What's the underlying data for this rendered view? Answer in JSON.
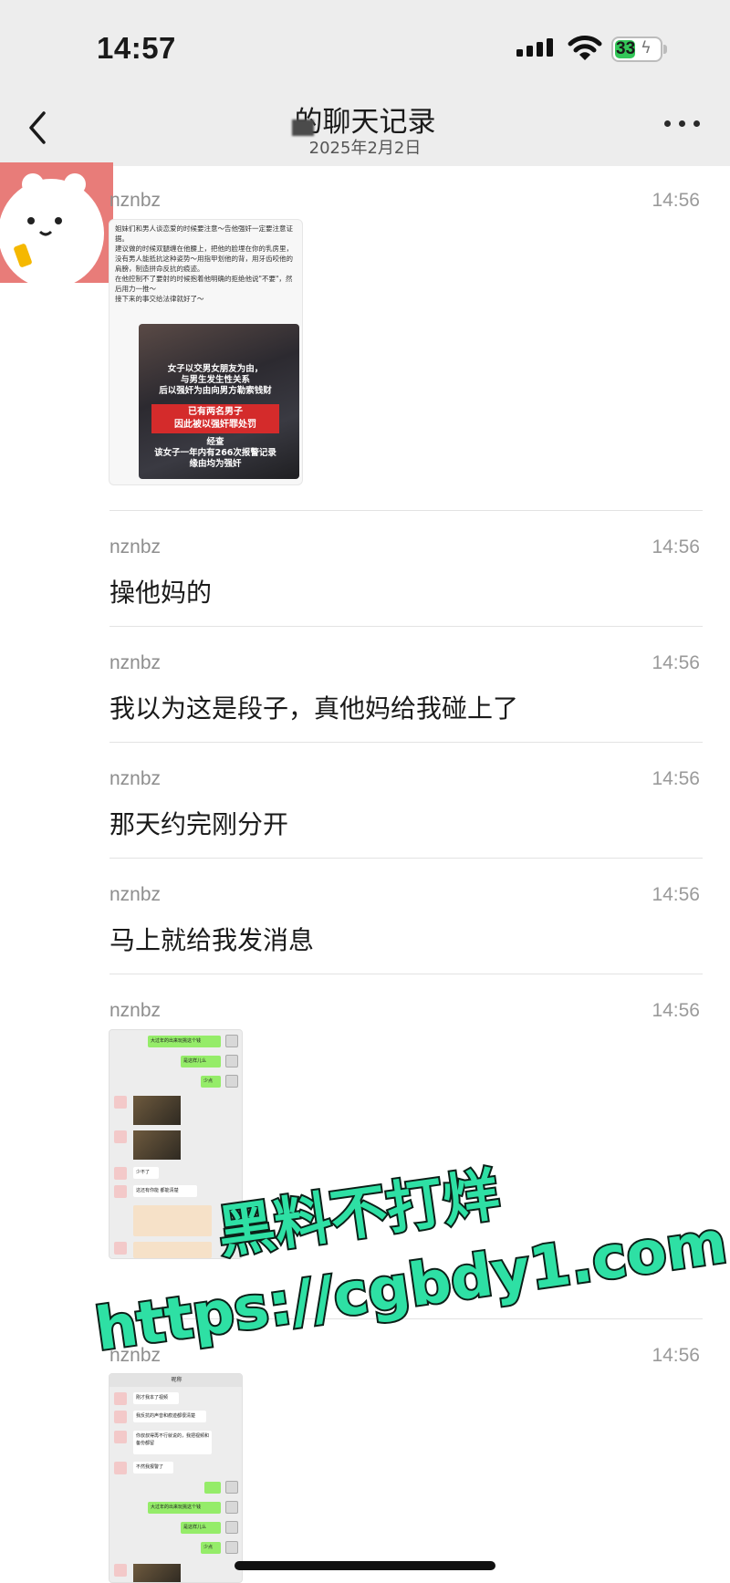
{
  "status_bar": {
    "time": "14:57",
    "battery": "33"
  },
  "header": {
    "title": "的聊天记录",
    "subtitle": "2025年2月2日"
  },
  "messages": [
    {
      "sender": "nznbz",
      "time": "14:56",
      "type": "image"
    },
    {
      "sender": "nznbz",
      "time": "14:56",
      "text": "操他妈的"
    },
    {
      "sender": "nznbz",
      "time": "14:56",
      "text": "我以为这是段子，真他妈给我碰上了"
    },
    {
      "sender": "nznbz",
      "time": "14:56",
      "text": "那天约完刚分开"
    },
    {
      "sender": "nznbz",
      "time": "14:56",
      "text": "马上就给我发消息"
    },
    {
      "sender": "nznbz",
      "time": "14:56",
      "type": "image"
    },
    {
      "sender": "nznbz",
      "time": "14:56",
      "type": "image"
    }
  ],
  "image1": {
    "post_text": "姐妹们和男人谈恋爱的时候要注意～告他强奸一定要注意证据。\n建议做的时候双腿缠在他腰上，把他的脸埋在你的乳房里，没有男人能抵抗这种姿势～用指甲划他的背，用牙齿咬他的肩膀，制造拼命反抗的痕迹。\n在他控制不了要射的时候抱着他明确的拒绝他说\"不要\"，然后用力一推～\n接下来的事交给法律就好了～",
    "caption_1": "女子以交男女朋友为由，\n与男生发生性关系\n后以强奸为由向男方勒索钱财",
    "caption_red": "已有两名男子\n因此被以强奸罪处罚",
    "caption_2": "经查\n该女子一年内有266次报警记录\n缘由均为强奸"
  },
  "image2": {
    "bubbles": [
      "大过年的出来玩挑这个钱",
      "是这样儿么",
      "少点",
      "少不了",
      "这还有你能 都能清楚"
    ]
  },
  "image3": {
    "title": "昵称",
    "bubbles": [
      "刚才我本了视频",
      "我反抗的声音和痕迹都很清楚",
      "你叔叔得再不行就说的，我把视频和备份都留",
      "不然我报警了",
      "大过年的出来玩挑这个钱",
      "是这样儿么",
      "少点"
    ]
  },
  "watermark": {
    "line1": "黑料不打烊",
    "line2": "https://cgbdy1.com"
  },
  "colors": {
    "wechat_green": "#95ec69",
    "watermark_fill": "#2ee0a4",
    "header_bg": "#ededed"
  }
}
